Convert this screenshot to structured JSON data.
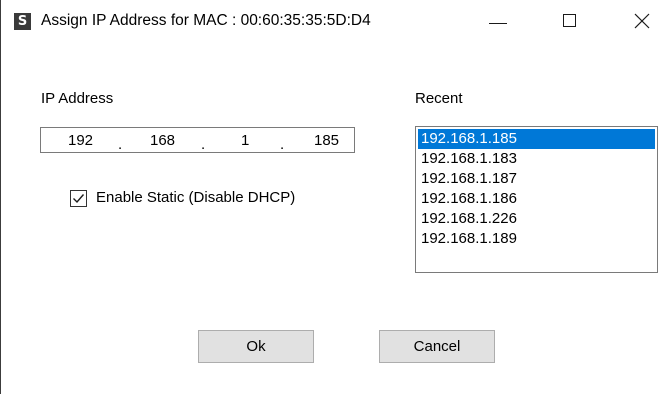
{
  "window": {
    "title": "Assign IP Address for MAC : 00:60:35:35:5D:D4",
    "icon_letter": "S",
    "controls": [
      "minimize-icon",
      "maximize-icon",
      "close-icon"
    ]
  },
  "ip_address": {
    "label": "IP Address",
    "octets": [
      "192",
      "168",
      "1",
      "185"
    ],
    "separator": "."
  },
  "static": {
    "label": "Enable Static (Disable DHCP)",
    "checked": true
  },
  "recent": {
    "label": "Recent",
    "items": [
      "192.168.1.185",
      "192.168.1.183",
      "192.168.1.187",
      "192.168.1.186",
      "192.168.1.226",
      "192.168.1.189"
    ],
    "selected_index": 0,
    "selected_color": "#0078d7"
  },
  "buttons": {
    "ok": "Ok",
    "cancel": "Cancel"
  }
}
